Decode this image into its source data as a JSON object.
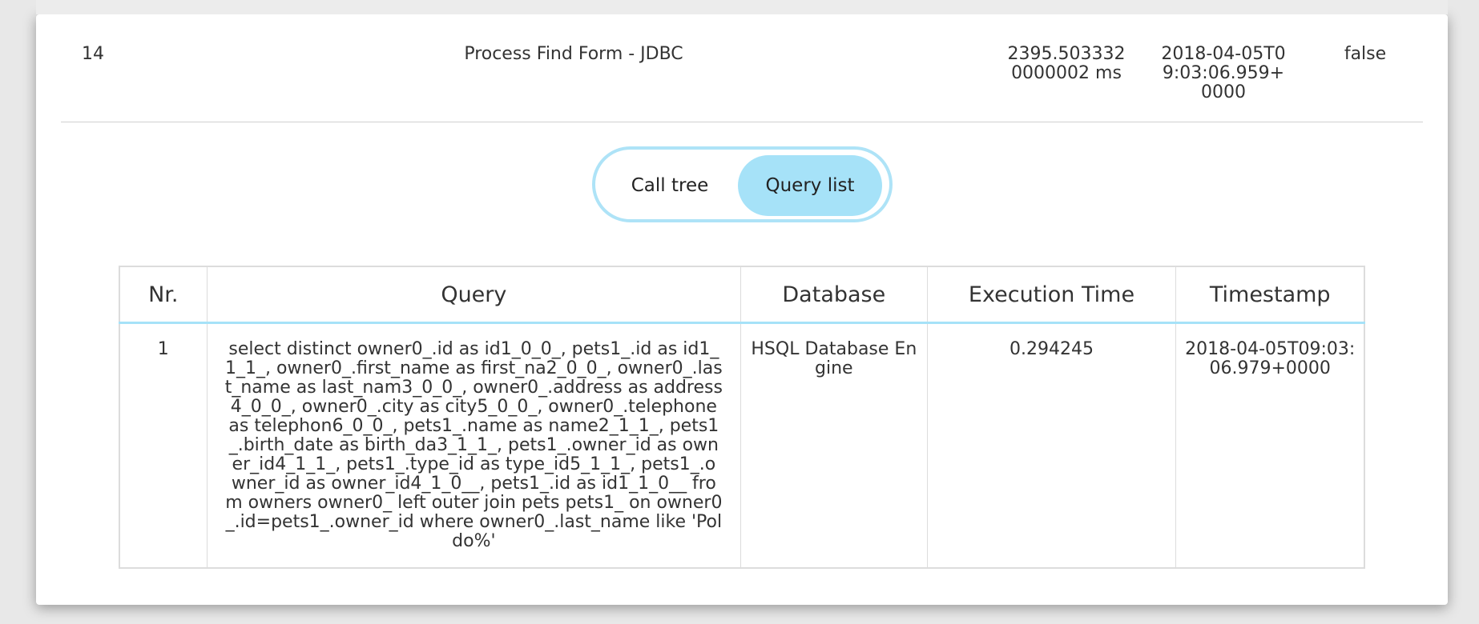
{
  "summary": {
    "id": "14",
    "name": "Process Find Form - JDBC",
    "duration": "2395.5033320000002 ms",
    "timestamp": "2018-04-05T09:03:06.959+0000",
    "error": "false"
  },
  "toggle": {
    "options": [
      "Call tree",
      "Query list"
    ],
    "selected": "Query list"
  },
  "colors": {
    "accent": "#a6e2f8",
    "accent_border": "#aee3f7"
  },
  "query_table": {
    "headers": [
      "Nr.",
      "Query",
      "Database",
      "Execution Time",
      "Timestamp"
    ],
    "rows": [
      {
        "nr": "1",
        "query": "select distinct owner0_.id as id1_0_0_, pets1_.id as id1_1_1_, owner0_.first_name as first_na2_0_0_, owner0_.last_name as last_nam3_0_0_, owner0_.address as address4_0_0_, owner0_.city as city5_0_0_, owner0_.telephone as telephon6_0_0_, pets1_.name as name2_1_1_, pets1_.birth_date as birth_da3_1_1_, pets1_.owner_id as owner_id4_1_1_, pets1_.type_id as type_id5_1_1_, pets1_.owner_id as owner_id4_1_0__, pets1_.id as id1_1_0__ from owners owner0_ left outer join pets pets1_ on owner0_.id=pets1_.owner_id where owner0_.last_name like 'Poldo%'",
        "database": "HSQL Database Engine",
        "execution_time": "0.294245",
        "timestamp": "2018-04-05T09:03:06.979+0000"
      }
    ]
  }
}
